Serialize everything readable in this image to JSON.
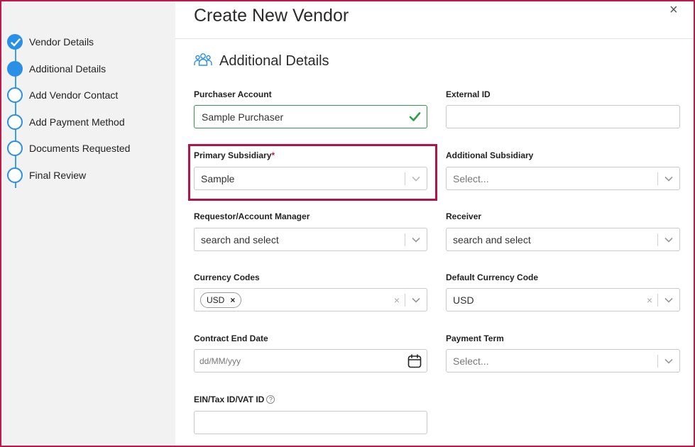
{
  "dialog": {
    "title": "Create New Vendor",
    "close_label": "×"
  },
  "stepper": {
    "steps": [
      {
        "label": "Vendor Details",
        "state": "completed"
      },
      {
        "label": "Additional Details",
        "state": "active"
      },
      {
        "label": "Add Vendor Contact",
        "state": "pending"
      },
      {
        "label": "Add Payment Method",
        "state": "pending"
      },
      {
        "label": "Documents Requested",
        "state": "pending"
      },
      {
        "label": "Final Review",
        "state": "pending"
      }
    ]
  },
  "section": {
    "title": "Additional Details",
    "icon": "group-icon"
  },
  "fields": {
    "purchaser_account": {
      "label": "Purchaser Account",
      "value": "Sample Purchaser"
    },
    "external_id": {
      "label": "External ID",
      "value": ""
    },
    "primary_subsidiary": {
      "label": "Primary Subsidiary",
      "required_mark": "*",
      "value": "Sample"
    },
    "additional_subsidiary": {
      "label": "Additional Subsidiary",
      "placeholder": "Select..."
    },
    "requestor": {
      "label": "Requestor/Account Manager",
      "placeholder": "search and select"
    },
    "receiver": {
      "label": "Receiver",
      "placeholder": "search and select"
    },
    "currency_codes": {
      "label": "Currency Codes",
      "chips": [
        "USD"
      ],
      "chip_remove": "×",
      "clear": "×"
    },
    "default_currency": {
      "label": "Default Currency Code",
      "value": "USD",
      "clear": "×"
    },
    "contract_end_date": {
      "label": "Contract End Date",
      "placeholder": "dd/MM/yyy"
    },
    "payment_term": {
      "label": "Payment Term",
      "placeholder": "Select..."
    },
    "ein": {
      "label": "EIN/Tax ID/VAT ID",
      "help": "?",
      "value": ""
    }
  },
  "colors": {
    "accent": "#2a8fe6",
    "valid": "#2e9d4a",
    "highlight": "#b01545",
    "required": "#c0184a"
  }
}
